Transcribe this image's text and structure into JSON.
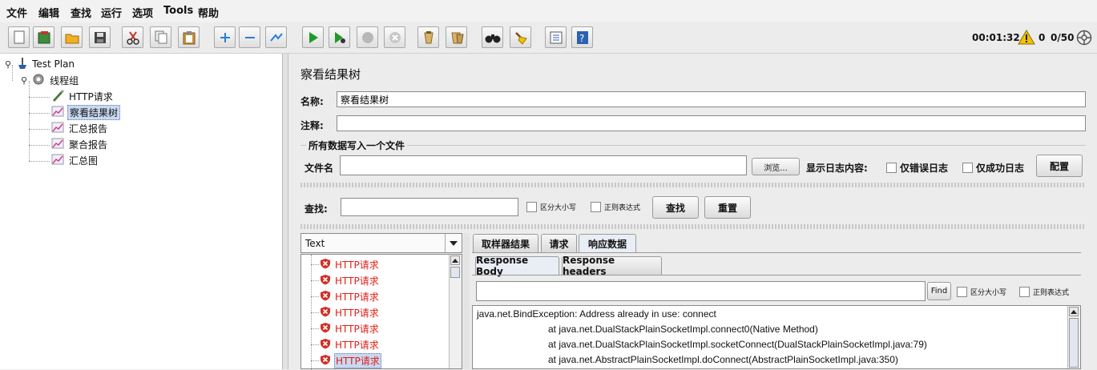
{
  "menu": [
    "文件",
    "编辑",
    "查找",
    "运行",
    "选项",
    "Tools",
    "帮助"
  ],
  "toolbar": {
    "icons": [
      "new-icon",
      "templates-icon",
      "open-icon",
      "save-icon",
      "cut-icon",
      "copy-icon",
      "paste-icon",
      "expand-icon",
      "collapse-icon",
      "toggle-icon",
      "start-icon",
      "start-no-pause-icon",
      "stop-icon",
      "shutdown-icon",
      "clear-icon",
      "clear-all-icon",
      "search-binoculars-icon",
      "reset-search-icon",
      "function-helper-icon",
      "help-icon"
    ],
    "timer": "00:01:32",
    "warnings": "0",
    "threads": "0/50"
  },
  "tree": {
    "root": "Test Plan",
    "thread_group": "线程组",
    "children": [
      "HTTP请求",
      "察看结果树",
      "汇总报告",
      "聚合报告",
      "汇总图"
    ],
    "selected": "察看结果树"
  },
  "panel": {
    "title": "察看结果树",
    "name_label": "名称:",
    "name_value": "察看结果树",
    "comment_label": "注释:",
    "comment_value": "",
    "file_group": "所有数据写入一个文件",
    "file_label": "文件名",
    "file_value": "",
    "browse": "浏览...",
    "log_label": "显示日志内容:",
    "errors_only": "仅错误日志",
    "success_only": "仅成功日志",
    "configure": "配置",
    "search_label": "查找:",
    "search_value": "",
    "case_sensitive": "区分大小写",
    "regex": "正则表达式",
    "search_button": "查找",
    "reset_button": "重置"
  },
  "results": {
    "renderer": "Text",
    "items": [
      "HTTP请求",
      "HTTP请求",
      "HTTP请求",
      "HTTP请求",
      "HTTP请求",
      "HTTP请求",
      "HTTP请求"
    ],
    "selected_index": 6
  },
  "tabs": [
    "取样器结果",
    "请求",
    "响应数据"
  ],
  "subtabs": [
    "Response Body",
    "Response headers"
  ],
  "find": {
    "value": "",
    "button": "Find",
    "case_sensitive": "区分大小写",
    "regex": "正则表达式"
  },
  "response_lines": [
    "java.net.BindException: Address already in use: connect",
    "at java.net.DualStackPlainSocketImpl.connect0(Native Method)",
    "at java.net.DualStackPlainSocketImpl.socketConnect(DualStackPlainSocketImpl.java:79)",
    "at java.net.AbstractPlainSocketImpl.doConnect(AbstractPlainSocketImpl.java:350)"
  ],
  "colors": {
    "error_text": "#e0201a",
    "selection": "#c9d9f0",
    "warning": "#f2c200"
  }
}
